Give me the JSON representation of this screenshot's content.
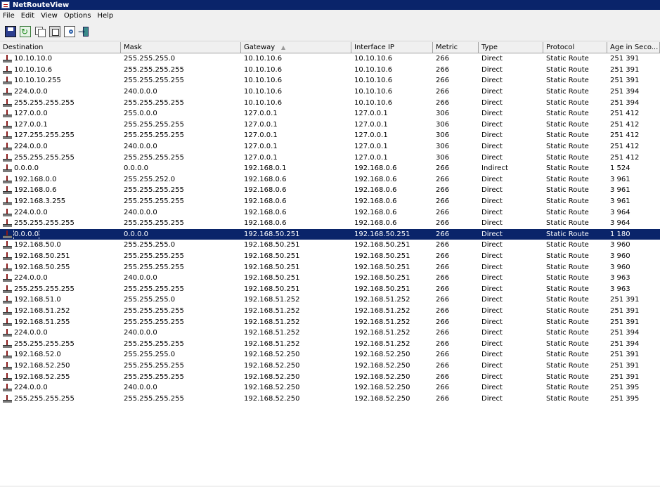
{
  "window": {
    "title": "NetRouteView"
  },
  "menu": [
    "File",
    "Edit",
    "View",
    "Options",
    "Help"
  ],
  "toolbar": [
    {
      "name": "save-icon"
    },
    {
      "name": "refresh-icon"
    },
    {
      "name": "copy-icon"
    },
    {
      "name": "properties-icon"
    },
    {
      "name": "html-report-icon"
    },
    {
      "name": "exit-icon"
    }
  ],
  "columns": [
    "Destination",
    "Mask",
    "Gateway",
    "Interface IP",
    "Metric",
    "Type",
    "Protocol",
    "Age in Seco..."
  ],
  "sort": {
    "column": "Gateway",
    "direction": "ascending"
  },
  "selected_row_index": 16,
  "rows": [
    [
      "10.10.10.0",
      "255.255.255.0",
      "10.10.10.6",
      "10.10.10.6",
      "266",
      "Direct",
      "Static Route",
      "251 391"
    ],
    [
      "10.10.10.6",
      "255.255.255.255",
      "10.10.10.6",
      "10.10.10.6",
      "266",
      "Direct",
      "Static Route",
      "251 391"
    ],
    [
      "10.10.10.255",
      "255.255.255.255",
      "10.10.10.6",
      "10.10.10.6",
      "266",
      "Direct",
      "Static Route",
      "251 391"
    ],
    [
      "224.0.0.0",
      "240.0.0.0",
      "10.10.10.6",
      "10.10.10.6",
      "266",
      "Direct",
      "Static Route",
      "251 394"
    ],
    [
      "255.255.255.255",
      "255.255.255.255",
      "10.10.10.6",
      "10.10.10.6",
      "266",
      "Direct",
      "Static Route",
      "251 394"
    ],
    [
      "127.0.0.0",
      "255.0.0.0",
      "127.0.0.1",
      "127.0.0.1",
      "306",
      "Direct",
      "Static Route",
      "251 412"
    ],
    [
      "127.0.0.1",
      "255.255.255.255",
      "127.0.0.1",
      "127.0.0.1",
      "306",
      "Direct",
      "Static Route",
      "251 412"
    ],
    [
      "127.255.255.255",
      "255.255.255.255",
      "127.0.0.1",
      "127.0.0.1",
      "306",
      "Direct",
      "Static Route",
      "251 412"
    ],
    [
      "224.0.0.0",
      "240.0.0.0",
      "127.0.0.1",
      "127.0.0.1",
      "306",
      "Direct",
      "Static Route",
      "251 412"
    ],
    [
      "255.255.255.255",
      "255.255.255.255",
      "127.0.0.1",
      "127.0.0.1",
      "306",
      "Direct",
      "Static Route",
      "251 412"
    ],
    [
      "0.0.0.0",
      "0.0.0.0",
      "192.168.0.1",
      "192.168.0.6",
      "266",
      "Indirect",
      "Static Route",
      "1 524"
    ],
    [
      "192.168.0.0",
      "255.255.252.0",
      "192.168.0.6",
      "192.168.0.6",
      "266",
      "Direct",
      "Static Route",
      "3 961"
    ],
    [
      "192.168.0.6",
      "255.255.255.255",
      "192.168.0.6",
      "192.168.0.6",
      "266",
      "Direct",
      "Static Route",
      "3 961"
    ],
    [
      "192.168.3.255",
      "255.255.255.255",
      "192.168.0.6",
      "192.168.0.6",
      "266",
      "Direct",
      "Static Route",
      "3 961"
    ],
    [
      "224.0.0.0",
      "240.0.0.0",
      "192.168.0.6",
      "192.168.0.6",
      "266",
      "Direct",
      "Static Route",
      "3 964"
    ],
    [
      "255.255.255.255",
      "255.255.255.255",
      "192.168.0.6",
      "192.168.0.6",
      "266",
      "Direct",
      "Static Route",
      "3 964"
    ],
    [
      "0.0.0.0",
      "0.0.0.0",
      "192.168.50.251",
      "192.168.50.251",
      "266",
      "Direct",
      "Static Route",
      "1 180"
    ],
    [
      "192.168.50.0",
      "255.255.255.0",
      "192.168.50.251",
      "192.168.50.251",
      "266",
      "Direct",
      "Static Route",
      "3 960"
    ],
    [
      "192.168.50.251",
      "255.255.255.255",
      "192.168.50.251",
      "192.168.50.251",
      "266",
      "Direct",
      "Static Route",
      "3 960"
    ],
    [
      "192.168.50.255",
      "255.255.255.255",
      "192.168.50.251",
      "192.168.50.251",
      "266",
      "Direct",
      "Static Route",
      "3 960"
    ],
    [
      "224.0.0.0",
      "240.0.0.0",
      "192.168.50.251",
      "192.168.50.251",
      "266",
      "Direct",
      "Static Route",
      "3 963"
    ],
    [
      "255.255.255.255",
      "255.255.255.255",
      "192.168.50.251",
      "192.168.50.251",
      "266",
      "Direct",
      "Static Route",
      "3 963"
    ],
    [
      "192.168.51.0",
      "255.255.255.0",
      "192.168.51.252",
      "192.168.51.252",
      "266",
      "Direct",
      "Static Route",
      "251 391"
    ],
    [
      "192.168.51.252",
      "255.255.255.255",
      "192.168.51.252",
      "192.168.51.252",
      "266",
      "Direct",
      "Static Route",
      "251 391"
    ],
    [
      "192.168.51.255",
      "255.255.255.255",
      "192.168.51.252",
      "192.168.51.252",
      "266",
      "Direct",
      "Static Route",
      "251 391"
    ],
    [
      "224.0.0.0",
      "240.0.0.0",
      "192.168.51.252",
      "192.168.51.252",
      "266",
      "Direct",
      "Static Route",
      "251 394"
    ],
    [
      "255.255.255.255",
      "255.255.255.255",
      "192.168.51.252",
      "192.168.51.252",
      "266",
      "Direct",
      "Static Route",
      "251 394"
    ],
    [
      "192.168.52.0",
      "255.255.255.0",
      "192.168.52.250",
      "192.168.52.250",
      "266",
      "Direct",
      "Static Route",
      "251 391"
    ],
    [
      "192.168.52.250",
      "255.255.255.255",
      "192.168.52.250",
      "192.168.52.250",
      "266",
      "Direct",
      "Static Route",
      "251 391"
    ],
    [
      "192.168.52.255",
      "255.255.255.255",
      "192.168.52.250",
      "192.168.52.250",
      "266",
      "Direct",
      "Static Route",
      "251 391"
    ],
    [
      "224.0.0.0",
      "240.0.0.0",
      "192.168.52.250",
      "192.168.52.250",
      "266",
      "Direct",
      "Static Route",
      "251 395"
    ],
    [
      "255.255.255.255",
      "255.255.255.255",
      "192.168.52.250",
      "192.168.52.250",
      "266",
      "Direct",
      "Static Route",
      "251 395"
    ]
  ]
}
